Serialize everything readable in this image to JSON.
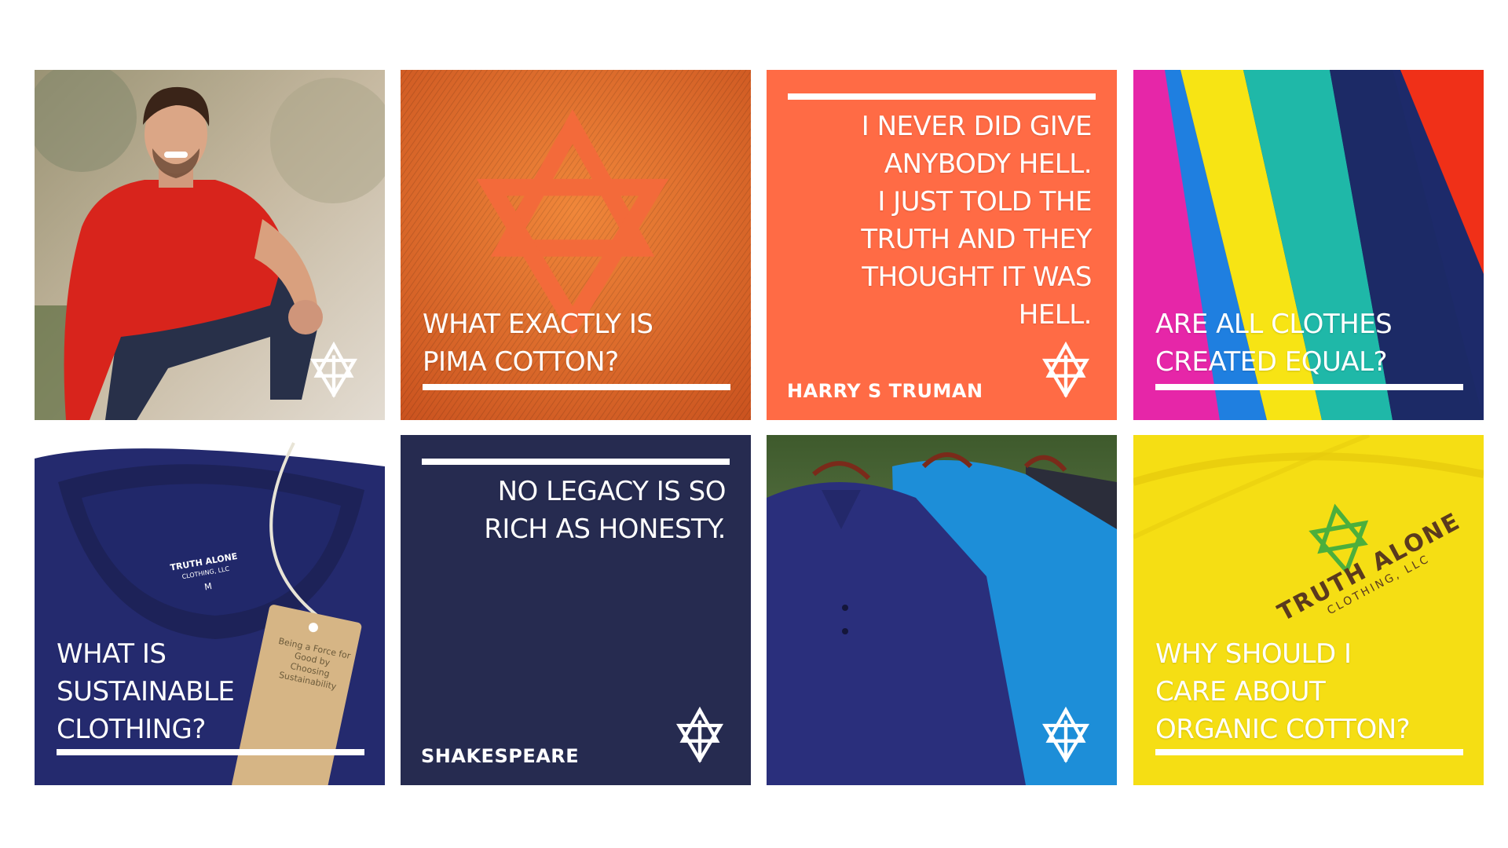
{
  "colors": {
    "red_shirt": "#d8241c",
    "orange": "#ea6a2a",
    "coral": "#ff6b45",
    "navy": "#262b50",
    "yellow": "#f5de14",
    "white": "#ffffff"
  },
  "tiles": {
    "model_photo": {
      "logo": "truth-alone-logo-icon"
    },
    "pima_cotton": {
      "caption_line1": "WHAT EXACTLY IS",
      "caption_line2": "PIMA COTTON?"
    },
    "truman_quote": {
      "quote_line1": "I NEVER DID GIVE",
      "quote_line2": "ANYBODY HELL.",
      "quote_line3": "I JUST TOLD THE",
      "quote_line4": "TRUTH AND THEY",
      "quote_line5": "THOUGHT IT WAS",
      "quote_line6": "HELL.",
      "attribution": "HARRY S TRUMAN"
    },
    "equal_clothes": {
      "caption_line1": "ARE ALL CLOTHES",
      "caption_line2": "CREATED EQUAL?"
    },
    "sustainable": {
      "caption_line1": "WHAT IS",
      "caption_line2": "SUSTAINABLE",
      "caption_line3": "CLOTHING?",
      "label_brand": "TRUTH ALONE",
      "label_sub": "CLOTHING, LLC",
      "label_size": "M",
      "tag_text": "Being a Force for Good by Choosing Sustainability"
    },
    "shakespeare_quote": {
      "quote_line1": "NO LEGACY IS SO",
      "quote_line2": "RICH AS HONESTY.",
      "attribution": "SHAKESPEARE"
    },
    "polos": {
      "logo": "truth-alone-logo-icon"
    },
    "organic_cotton": {
      "brand_line1": "TRUTH ALONE",
      "brand_line2": "CLOTHING, LLC",
      "caption_line1": "WHY SHOULD I",
      "caption_line2": "CARE ABOUT",
      "caption_line3": "ORGANIC COTTON?"
    }
  }
}
